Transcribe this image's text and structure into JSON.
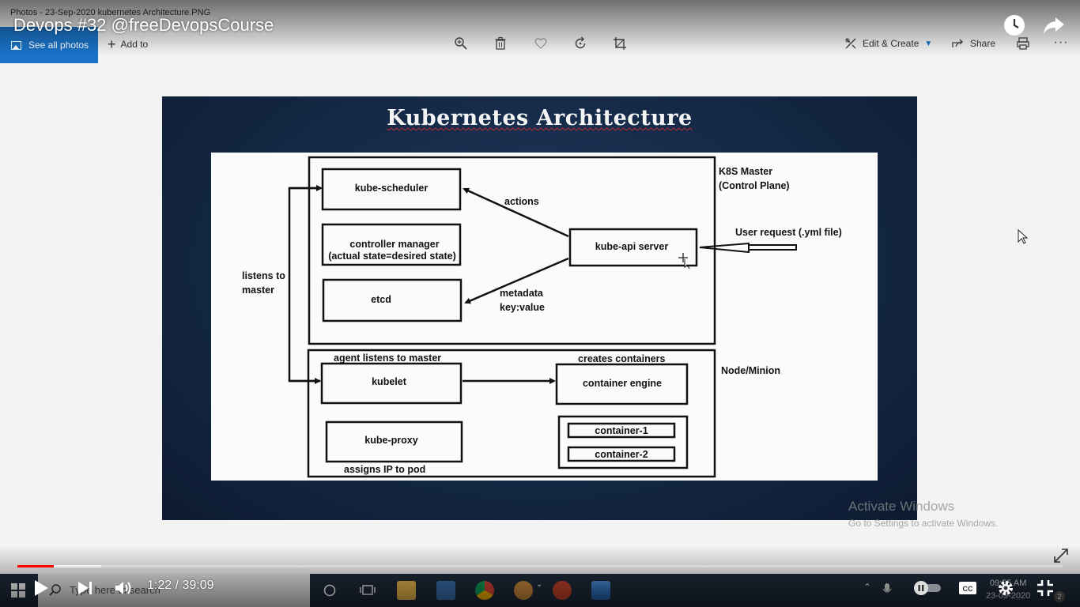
{
  "photos_app": {
    "window_title": "Photos - 23-Sep-2020 kubernetes Architecture.PNG",
    "see_all_photos": "See all photos",
    "add_to": "Add to",
    "edit_create": "Edit & Create",
    "share": "Share",
    "toolbar_icons": [
      "zoom-in-icon",
      "delete-icon",
      "favorite-icon",
      "rotate-icon",
      "crop-icon",
      "print-icon",
      "more-icon"
    ]
  },
  "video": {
    "title": "Devops #32 @freeDevopsCourse",
    "current_time": "1:22",
    "duration": "39:09",
    "time_display": "1:22 / 39:09",
    "played_fraction": 0.035,
    "buffered_fraction": 0.08,
    "progress_color": "#ff0000"
  },
  "slide": {
    "title": "Kubernetes Architecture",
    "master_label_1": "K8S Master",
    "master_label_2": "(Control Plane)",
    "node_label": "Node/Minion",
    "boxes": {
      "scheduler": "kube-scheduler",
      "controller_1": "controller manager",
      "controller_2": "(actual state=desired state)",
      "etcd": "etcd",
      "api_server": "kube-api server",
      "kubelet": "kubelet",
      "container_engine": "container engine",
      "kube_proxy": "kube-proxy",
      "container_1": "container-1",
      "container_2": "container-2"
    },
    "labels": {
      "actions": "actions",
      "metadata_1": "metadata",
      "metadata_2": "key:value",
      "user_request": "User request (.yml file)",
      "listens_1": "listens to",
      "listens_2": "master",
      "agent_listens": "agent listens to master",
      "creates_containers": "creates containers",
      "assigns_ip": "assigns IP to pod"
    }
  },
  "watermark": {
    "line1": "Activate Windows",
    "line2": "Go to Settings to activate Windows."
  },
  "taskbar": {
    "search_placeholder": "Type here to search",
    "clock_time": "09:55 AM",
    "clock_date": "23-09-2020",
    "notification_count": "2"
  }
}
